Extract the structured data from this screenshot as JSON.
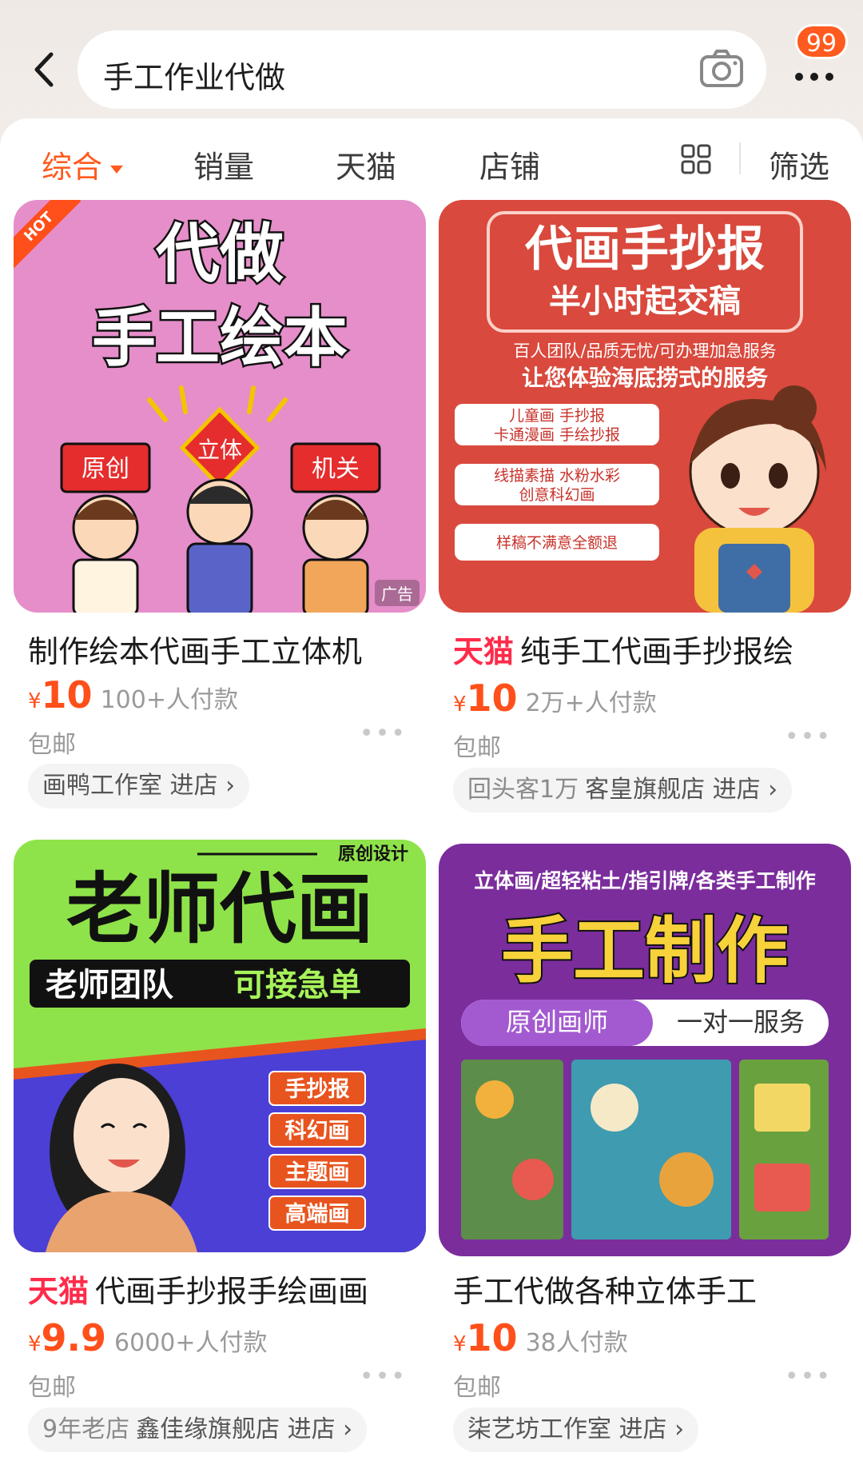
{
  "search": {
    "query": "手工作业代做",
    "cart_badge": "99"
  },
  "tabs": [
    {
      "label": "综合",
      "active": true
    },
    {
      "label": "销量"
    },
    {
      "label": "天猫"
    },
    {
      "label": "店铺"
    },
    {
      "label": "筛选"
    }
  ],
  "products": [
    {
      "title": "制作绘本代画手工立体机",
      "tmall": false,
      "price": "10",
      "sales": "100+人付款",
      "shipping": "包邮",
      "shop_prefix": "",
      "shop": "画鸭工作室 进店",
      "image": {
        "hot": "HOT",
        "ad": "广告",
        "line1": "代做",
        "line2": "手工绘本",
        "sign1": "原创",
        "sign2": "立体",
        "sign3": "机关"
      }
    },
    {
      "title": "纯手工代画手抄报绘",
      "tmall": true,
      "tmall_label": "天猫",
      "price": "10",
      "sales": "2万+人付款",
      "shipping": "包邮",
      "shop_prefix": "回头客1万",
      "shop": "客皇旗舰店 进店",
      "image": {
        "line1": "代画手抄报",
        "line2": "半小时起交稿",
        "line3": "百人团队/品质无忧/可办理加急服务",
        "line4": "让您体验海底捞式的服务",
        "btn1a": "儿童画 手抄报",
        "btn1b": "卡通漫画 手绘抄报",
        "btn2a": "线描素描 水粉水彩",
        "btn2b": "创意科幻画",
        "btn3": "样稿不满意全额退"
      }
    },
    {
      "title": "代画手抄报手绘画画",
      "tmall": true,
      "tmall_label": "天猫",
      "price": "9.9",
      "sales": "6000+人付款",
      "shipping": "包邮",
      "shop_prefix": "9年老店",
      "shop": "鑫佳缘旗舰店 进店",
      "image": {
        "tag": "原创设计",
        "line1": "老师代画",
        "line2a": "老师团队",
        "line2b": "可接急单",
        "items": [
          "手抄报",
          "科幻画",
          "主题画",
          "高端画"
        ]
      }
    },
    {
      "title": "手工代做各种立体手工",
      "tmall": false,
      "price": "10",
      "sales": "38人付款",
      "shipping": "包邮",
      "shop_prefix": "",
      "shop": "柒艺坊工作室 进店",
      "image": {
        "line1": "立体画/超轻粘土/指引牌/各类手工制作",
        "line2": "手工制作",
        "pill_left": "原创画师",
        "pill_right": "一对一服务"
      }
    }
  ]
}
